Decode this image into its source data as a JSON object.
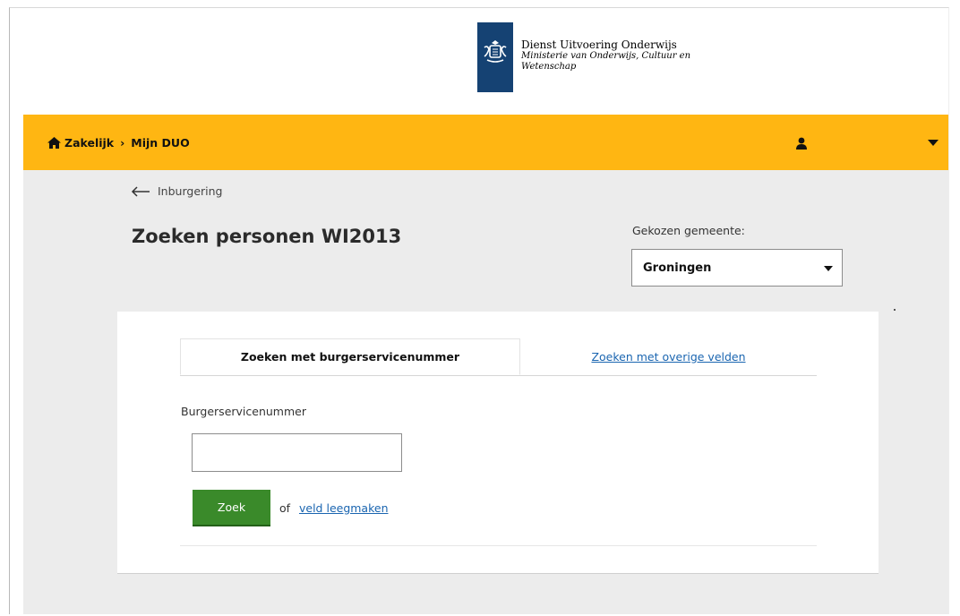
{
  "logo": {
    "line1": "Dienst Uitvoering Onderwijs",
    "line2": "Ministerie van Onderwijs, Cultuur en",
    "line3": "Wetenschap",
    "emblem_icon": "coat-of-arms-icon",
    "emblem_color": "#154273"
  },
  "nav": {
    "home_icon": "home-icon",
    "breadcrumb": [
      "Zakelijk",
      "Mijn DUO"
    ],
    "separator": "›",
    "user_icon": "user-icon",
    "menu_icon": "chevron-down-icon",
    "bar_color": "#ffb612"
  },
  "back": {
    "label": "Inburgering",
    "icon": "arrow-left-icon"
  },
  "page": {
    "title": "Zoeken personen WI2013"
  },
  "gemeente": {
    "label": "Gekozen gemeente:",
    "selected": "Groningen"
  },
  "tabs": [
    {
      "label": "Zoeken met burgerservicenummer",
      "active": true
    },
    {
      "label": "Zoeken met overige velden",
      "active": false
    }
  ],
  "form": {
    "bsn_label": "Burgerservicenummer",
    "bsn_value": "",
    "submit_label": "Zoek",
    "or_text": "of",
    "clear_label": "veld leegmaken",
    "button_color": "#3a8a2a"
  }
}
